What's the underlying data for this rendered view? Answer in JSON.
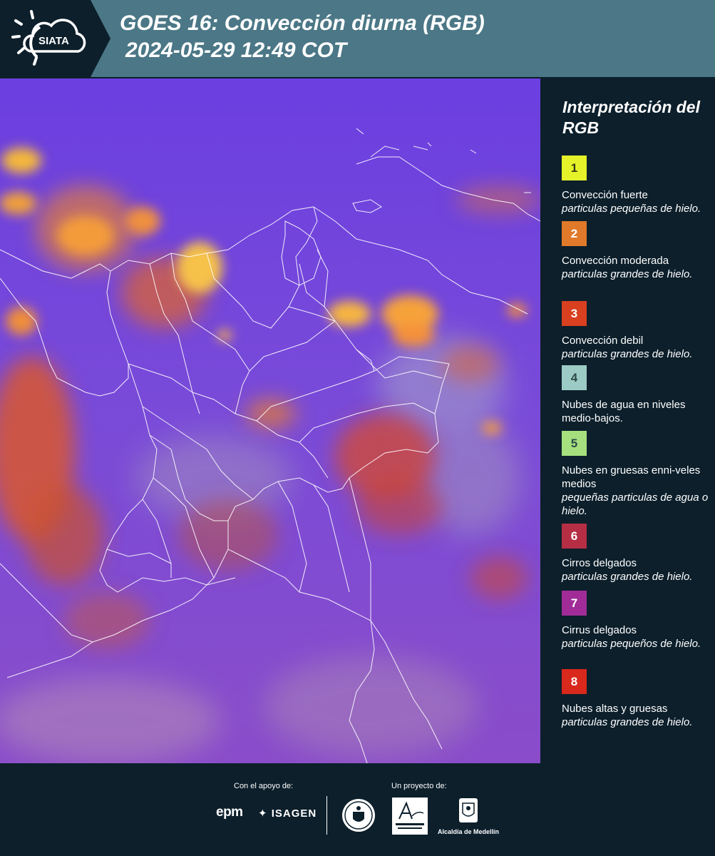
{
  "header": {
    "logo_text": "SIATA",
    "title_line1": "GOES 16: Convección diurna (RGB)",
    "title_line2": "2024-05-29 12:49 COT"
  },
  "legend": {
    "title": "Interpretación del RGB",
    "items": [
      {
        "number": "1",
        "color": "#e6f229",
        "title": "Convección fuerte",
        "subtitle": "particulas pequeñas de hielo."
      },
      {
        "number": "2",
        "color": "#e0792a",
        "title": "Convección moderada",
        "subtitle": "particulas grandes de hielo."
      },
      {
        "number": "3",
        "color": "#d8401f",
        "title": "Convección debil",
        "subtitle": "particulas grandes de hielo."
      },
      {
        "number": "4",
        "color": "#9ccbc5",
        "title": "Nubes de agua en niveles medio-bajos.",
        "subtitle": ""
      },
      {
        "number": "5",
        "color": "#a6e07e",
        "title": "Nubes en gruesas enni-veles medios",
        "subtitle": "pequeñas particulas de agua o hielo."
      },
      {
        "number": "6",
        "color": "#b62e44",
        "title": "Cirros delgados",
        "subtitle": "particulas grandes de hielo."
      },
      {
        "number": "7",
        "color": "#a12c98",
        "title": "Cirrus delgados",
        "subtitle": "particulas pequeños de hielo."
      },
      {
        "number": "8",
        "color": "#d9281c",
        "title": "Nubes altas y gruesas",
        "subtitle": "particulas grandes de hielo."
      }
    ]
  },
  "footer": {
    "support_label": "Con el apoyo de:",
    "project_label": "Un proyecto de:",
    "sponsor_epm": "epm",
    "sponsor_isagen": "ISAGEN",
    "partner_medellin": "Alcaldía de Medellín"
  }
}
